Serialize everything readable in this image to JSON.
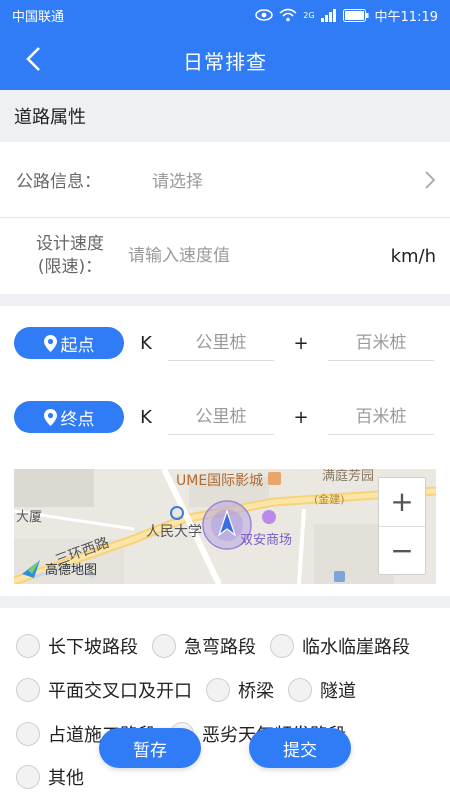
{
  "status": {
    "carrier": "中国联通",
    "time": "中午11:19",
    "net": "2G"
  },
  "nav": {
    "title": "日常排查"
  },
  "section": {
    "title": "道路属性"
  },
  "road_info": {
    "label": "公路信息：",
    "placeholder": "请选择"
  },
  "speed": {
    "label_line1": "设计速度",
    "label_line2": "(限速)：",
    "placeholder": "请输入速度值",
    "unit": "km/h"
  },
  "start": {
    "label": "起点",
    "k": "K",
    "km_placeholder": "公里桩",
    "plus": "+",
    "hm_placeholder": "百米桩"
  },
  "end": {
    "label": "终点",
    "k": "K",
    "km_placeholder": "公里桩",
    "plus": "+",
    "hm_placeholder": "百米桩"
  },
  "map": {
    "poi_ume": "UME国际影城",
    "poi_mt": "满庭芳园",
    "poi_dasha": "大厦",
    "poi_rmdx": "人民大学",
    "poi_shuangan": "双安商场",
    "road_huan": "三环西路",
    "road_jin": "(金建)",
    "logo": "高德地图",
    "zoom_in": "+",
    "zoom_out": "−"
  },
  "checks": [
    "长下坡路段",
    "急弯路段",
    "临水临崖路段",
    "平面交叉口及开口",
    "桥梁",
    "隧道",
    "占道施工路段",
    "恶劣天气频发路段",
    "其他"
  ],
  "buttons": {
    "save": "暂存",
    "submit": "提交"
  },
  "colors": {
    "primary": "#2f7cf6"
  }
}
